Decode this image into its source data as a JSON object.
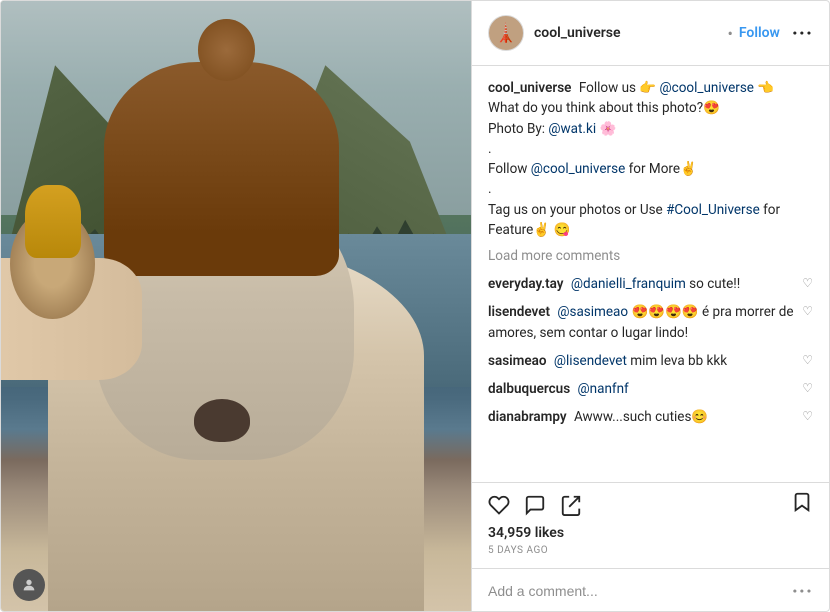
{
  "header": {
    "username": "cool_universe",
    "follow_label": "Follow",
    "dot": "•",
    "more_icon": "···",
    "avatar_icon": "🗼"
  },
  "caption": {
    "username": "cool_universe",
    "text_parts": [
      "Follow us 👉 ",
      "@cool_universe",
      " 👈",
      "\nWhat do you think about this photo?😍\nPhoto By: @wat.ki 🌸\n.\nFollow ",
      "@cool_universe",
      " for More✌\n.\nTag us on your photos or Use ",
      "#Cool_Universe",
      " for Feature✌ 😋"
    ]
  },
  "load_more": "Load more comments",
  "comments": [
    {
      "username": "everyday.tay",
      "text": " @danielli_franquim so cute!!"
    },
    {
      "username": "lisendevet",
      "text": " @sasimeao 😍😍😍😍 é pra morrer de amores, sem contar o lugar lindo!"
    },
    {
      "username": "sasimeao",
      "text": " @lisendevet mim leva bb kkk"
    },
    {
      "username": "dalbuquercus",
      "text": " @nanfnf"
    },
    {
      "username": "dianabrampy",
      "text": " Awww...such cuties😊"
    }
  ],
  "likes": "34,959 likes",
  "timestamp": "5 DAYS AGO",
  "add_comment_placeholder": "Add a comment...",
  "actions": {
    "like_icon": "heart",
    "comment_icon": "comment",
    "share_icon": "share",
    "bookmark_icon": "bookmark"
  }
}
